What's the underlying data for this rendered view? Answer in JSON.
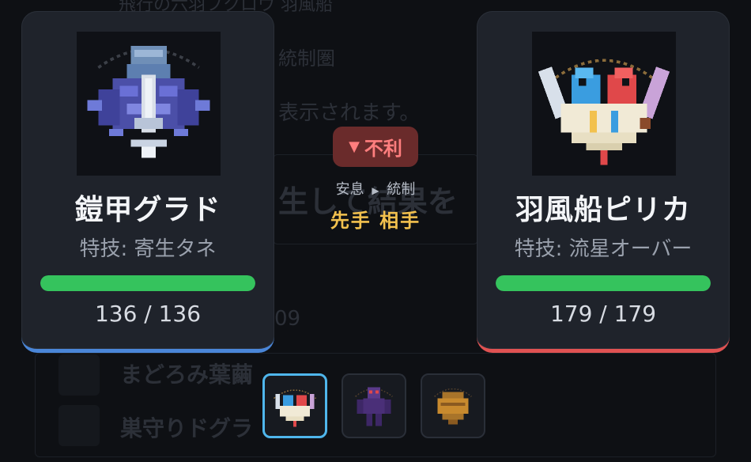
{
  "background_list": {
    "row_top": "飛行の六羽フクロウ 羽風船",
    "row_effect": "統制圏",
    "row_note": "表示されます。",
    "row_big": "生して結果を",
    "row_number": "09",
    "row_name_1": "まどろみ葉繭",
    "row_name_2": "巣守りドグラ"
  },
  "player": {
    "name": "鎧甲グラド",
    "skill": "特技: 寄生タネ",
    "hp_current": 136,
    "hp_max": 136,
    "hp_text": "136 / 136",
    "hp_fraction": 1.0,
    "accent_color": "#4a86d8",
    "portrait_icon": "armored-beetle-sprite"
  },
  "opponent": {
    "name": "羽風船ピリカ",
    "skill": "特技: 流星オーバー",
    "hp_current": 179,
    "hp_max": 179,
    "hp_text": "179 / 179",
    "hp_fraction": 1.0,
    "accent_color": "#e05252",
    "portrait_icon": "twin-bird-balloon-sprite"
  },
  "matchup": {
    "badge_icon": "down-triangle-icon",
    "badge_text": "不利",
    "from_type": "安息",
    "arrow": "▶",
    "to_type": "統制",
    "turn_text": "先手 相手"
  },
  "party": [
    {
      "icon": "twin-bird-balloon-sprite",
      "selected": true
    },
    {
      "icon": "purple-humanoid-sprite",
      "selected": false
    },
    {
      "icon": "amber-shell-sprite",
      "selected": false
    }
  ],
  "colors": {
    "hp_bar": "#35c35d",
    "disadvantage_bg": "#6a2b2b",
    "disadvantage_text": "#ff7e7e",
    "turn_text": "#f2c14e",
    "selected_slot": "#4fb6ec"
  }
}
